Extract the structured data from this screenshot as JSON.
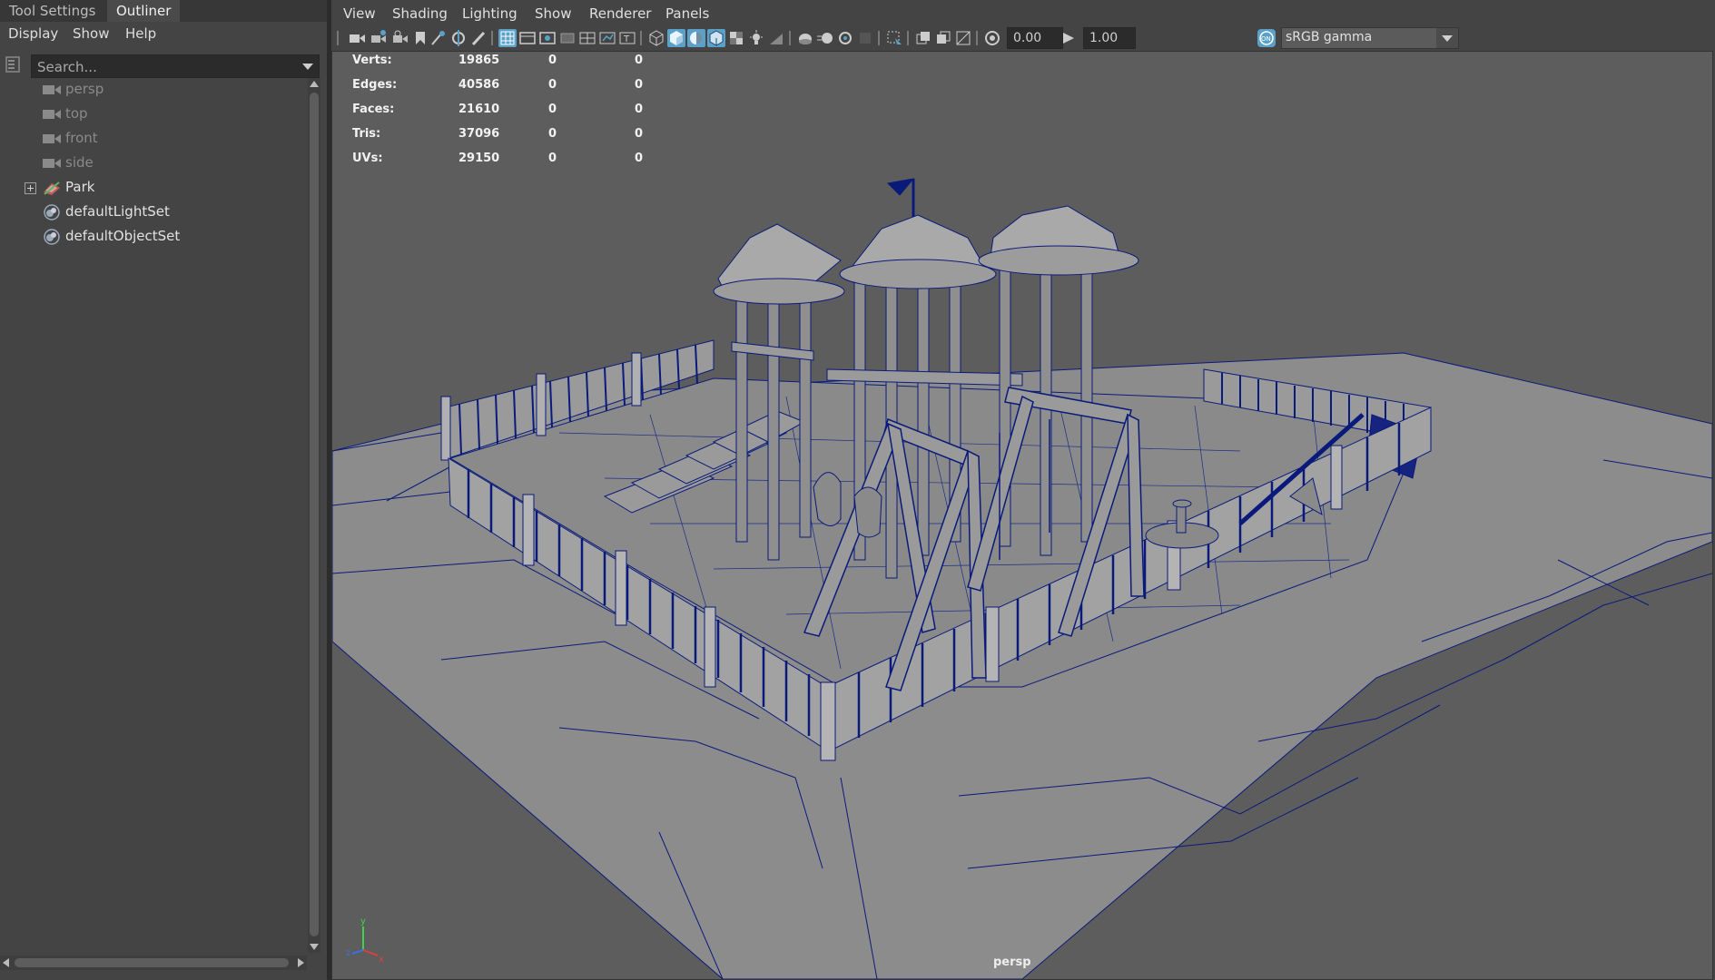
{
  "outliner": {
    "tabs": [
      {
        "label": "Tool Settings"
      },
      {
        "label": "Outliner"
      }
    ],
    "menu": [
      "Display",
      "Show",
      "Help"
    ],
    "search": {
      "placeholder": "Search..."
    },
    "nodes": [
      {
        "label": "persp",
        "icon": "camera-icon"
      },
      {
        "label": "top",
        "icon": "camera-icon"
      },
      {
        "label": "front",
        "icon": "camera-icon"
      },
      {
        "label": "side",
        "icon": "camera-icon"
      },
      {
        "label": "Park",
        "icon": "transform-group-icon"
      },
      {
        "label": "defaultLightSet",
        "icon": "set-icon"
      },
      {
        "label": "defaultObjectSet",
        "icon": "set-icon"
      }
    ]
  },
  "viewport": {
    "menu": [
      "View",
      "Shading",
      "Lighting",
      "Show",
      "Renderer",
      "Panels"
    ],
    "toolbar": {
      "exposure": "0.00",
      "gamma": "1.00",
      "color_space": "sRGB gamma"
    },
    "hud": [
      {
        "label": "Verts:",
        "values": [
          "19865",
          "0",
          "0"
        ]
      },
      {
        "label": "Edges:",
        "values": [
          "40586",
          "0",
          "0"
        ]
      },
      {
        "label": "Faces:",
        "values": [
          "21610",
          "0",
          "0"
        ]
      },
      {
        "label": "Tris:",
        "values": [
          "37096",
          "0",
          "0"
        ]
      },
      {
        "label": "UVs:",
        "values": [
          "29150",
          "0",
          "0"
        ]
      }
    ],
    "camera_label": "persp",
    "axis_labels": {
      "x": "x",
      "y": "y",
      "z": "z"
    },
    "wire_color": "#0a1a7a",
    "shade_color": "#8c8c8c",
    "background_color": "#5d5d5d",
    "toggle_color": "#5aa0c8"
  }
}
